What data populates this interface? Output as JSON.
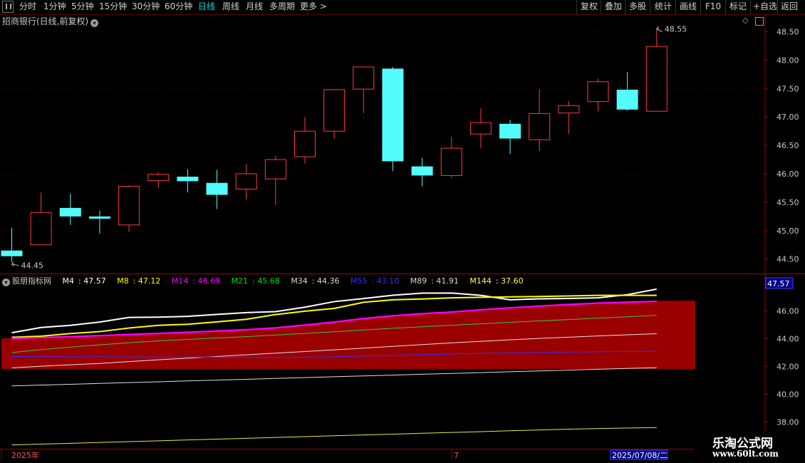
{
  "toolbar": {
    "periods": [
      "分时",
      "1分钟",
      "5分钟",
      "15分钟",
      "30分钟",
      "60分钟",
      "日线",
      "周线",
      "月线",
      "多周期",
      "更多 >"
    ],
    "active_period": "日线",
    "right_buttons": [
      "复权",
      "叠加",
      "多股",
      "统计",
      "画线",
      "F10",
      "标记",
      "+自选",
      "返回"
    ]
  },
  "title": "招商银行(日线,前复权)",
  "colors": {
    "up": "#ff3b3b",
    "down": "#54fcfc",
    "axis": "#a00000",
    "grid": "#5a0000",
    "white": "#ffffff",
    "yellow": "#ffff00",
    "magenta": "#ff00ff",
    "green": "#00d000",
    "blue": "#3030ff",
    "fill": "#9a0000"
  },
  "chart_data": [
    {
      "type": "candlestick",
      "title": "招商银行(日线,前复权)",
      "y_ticks": [
        "48.50",
        "48.00",
        "47.50",
        "47.00",
        "46.50",
        "46.00",
        "45.50",
        "45.00",
        "44.50"
      ],
      "ylim": [
        44.3,
        48.65
      ],
      "max_label": "48.55",
      "min_label": "44.45",
      "candles": [
        {
          "o": 44.65,
          "c": 44.55,
          "h": 45.05,
          "l": 44.45
        },
        {
          "o": 44.75,
          "c": 45.32,
          "h": 45.67,
          "l": 44.74
        },
        {
          "o": 45.4,
          "c": 45.25,
          "h": 45.65,
          "l": 45.1
        },
        {
          "o": 45.25,
          "c": 45.21,
          "h": 45.35,
          "l": 44.95
        },
        {
          "o": 45.1,
          "c": 45.78,
          "h": 45.8,
          "l": 44.98
        },
        {
          "o": 45.88,
          "c": 45.99,
          "h": 46.03,
          "l": 45.75
        },
        {
          "o": 45.95,
          "c": 45.87,
          "h": 46.08,
          "l": 45.67
        },
        {
          "o": 45.84,
          "c": 45.63,
          "h": 46.07,
          "l": 45.38
        },
        {
          "o": 45.73,
          "c": 46.0,
          "h": 46.17,
          "l": 45.55
        },
        {
          "o": 45.91,
          "c": 46.25,
          "h": 46.32,
          "l": 45.45
        },
        {
          "o": 46.3,
          "c": 46.75,
          "h": 47.0,
          "l": 46.18
        },
        {
          "o": 46.75,
          "c": 47.48,
          "h": 47.49,
          "l": 46.62
        },
        {
          "o": 47.49,
          "c": 47.88,
          "h": 47.88,
          "l": 47.07
        },
        {
          "o": 47.85,
          "c": 46.22,
          "h": 47.88,
          "l": 46.05
        },
        {
          "o": 46.13,
          "c": 45.97,
          "h": 46.28,
          "l": 45.78
        },
        {
          "o": 45.97,
          "c": 46.45,
          "h": 46.65,
          "l": 45.93
        },
        {
          "o": 46.7,
          "c": 46.9,
          "h": 47.15,
          "l": 46.45
        },
        {
          "o": 46.88,
          "c": 46.62,
          "h": 46.95,
          "l": 46.35
        },
        {
          "o": 46.6,
          "c": 47.06,
          "h": 47.49,
          "l": 46.4
        },
        {
          "o": 47.07,
          "c": 47.2,
          "h": 47.28,
          "l": 46.7
        },
        {
          "o": 47.27,
          "c": 47.62,
          "h": 47.67,
          "l": 47.1
        },
        {
          "o": 47.48,
          "c": 47.13,
          "h": 47.79,
          "l": 47.11
        },
        {
          "o": 47.1,
          "c": 48.24,
          "h": 48.55,
          "l": 47.1
        }
      ]
    },
    {
      "type": "line",
      "title": "股朋指标网",
      "y_ticks": [
        "46.00",
        "44.00",
        "42.00",
        "40.00",
        "38.00"
      ],
      "ylim": [
        37.55,
        48.5
      ],
      "current_value_label": "47.57",
      "x_labels": [
        "2025年",
        "7",
        "2025/07/08/二"
      ],
      "series": [
        {
          "name": "M4",
          "value_label": "47.57",
          "color": "white",
          "values": [
            44.43,
            44.81,
            44.96,
            45.2,
            45.53,
            45.55,
            45.61,
            45.75,
            45.88,
            45.95,
            46.27,
            46.67,
            46.89,
            47.13,
            47.28,
            47.29,
            47.12,
            46.8,
            46.87,
            46.9,
            46.94,
            47.17,
            47.57
          ]
        },
        {
          "name": "M8",
          "value_label": "47.12",
          "color": "yellow",
          "values": [
            44.1,
            44.18,
            44.37,
            44.51,
            44.77,
            44.96,
            45.04,
            45.21,
            45.4,
            45.74,
            45.98,
            46.18,
            46.62,
            46.8,
            46.86,
            46.94,
            46.98,
            47.01,
            47.04,
            47.08,
            47.12,
            47.12,
            47.12
          ]
        },
        {
          "name": "M14",
          "value_label": "46.69",
          "color": "magenta",
          "values": [
            44.02,
            44.08,
            44.15,
            44.22,
            44.3,
            44.38,
            44.46,
            44.55,
            44.65,
            44.78,
            44.98,
            45.2,
            45.45,
            45.65,
            45.8,
            45.92,
            46.08,
            46.22,
            46.35,
            46.46,
            46.56,
            46.63,
            46.69
          ]
        },
        {
          "name": "M21",
          "value_label": "45.68",
          "color": "green",
          "values": [
            43.0,
            43.22,
            43.4,
            43.56,
            43.71,
            43.84,
            43.95,
            44.05,
            44.15,
            44.26,
            44.38,
            44.5,
            44.63,
            44.75,
            44.86,
            44.97,
            45.07,
            45.18,
            45.28,
            45.38,
            45.48,
            45.58,
            45.68
          ]
        },
        {
          "name": "M34",
          "value_label": "44.36",
          "color": "white-thin",
          "values": [
            41.9,
            42.02,
            42.12,
            42.22,
            42.35,
            42.48,
            42.6,
            42.72,
            42.84,
            42.96,
            43.08,
            43.2,
            43.32,
            43.45,
            43.58,
            43.7,
            43.81,
            43.92,
            44.02,
            44.11,
            44.2,
            44.28,
            44.36
          ]
        },
        {
          "name": "M55",
          "value_label": "43.10",
          "color": "blue",
          "values": [
            42.72,
            42.71,
            42.7,
            42.69,
            42.69,
            42.68,
            42.68,
            42.67,
            42.66,
            42.66,
            42.67,
            42.7,
            42.75,
            42.8,
            42.85,
            42.9,
            42.94,
            42.98,
            43.01,
            43.04,
            43.06,
            43.08,
            43.1
          ]
        },
        {
          "name": "M89",
          "value_label": "41.91",
          "color": "white-thin",
          "values": [
            40.6,
            40.66,
            40.72,
            40.78,
            40.84,
            40.9,
            40.96,
            41.02,
            41.08,
            41.14,
            41.2,
            41.26,
            41.32,
            41.38,
            41.44,
            41.5,
            41.56,
            41.62,
            41.68,
            41.74,
            41.8,
            41.86,
            41.91
          ]
        },
        {
          "name": "M144",
          "value_label": "37.60",
          "color": "yellow-thin",
          "values": [
            36.35,
            36.41,
            36.47,
            36.53,
            36.59,
            36.65,
            36.71,
            36.77,
            36.83,
            36.89,
            36.95,
            37.01,
            37.07,
            37.13,
            37.19,
            37.25,
            37.31,
            37.37,
            37.43,
            37.49,
            37.53,
            37.57,
            37.6
          ]
        }
      ]
    }
  ],
  "watermark": {
    "line1": "乐淘公式网",
    "line2": "www.60lt.com"
  }
}
